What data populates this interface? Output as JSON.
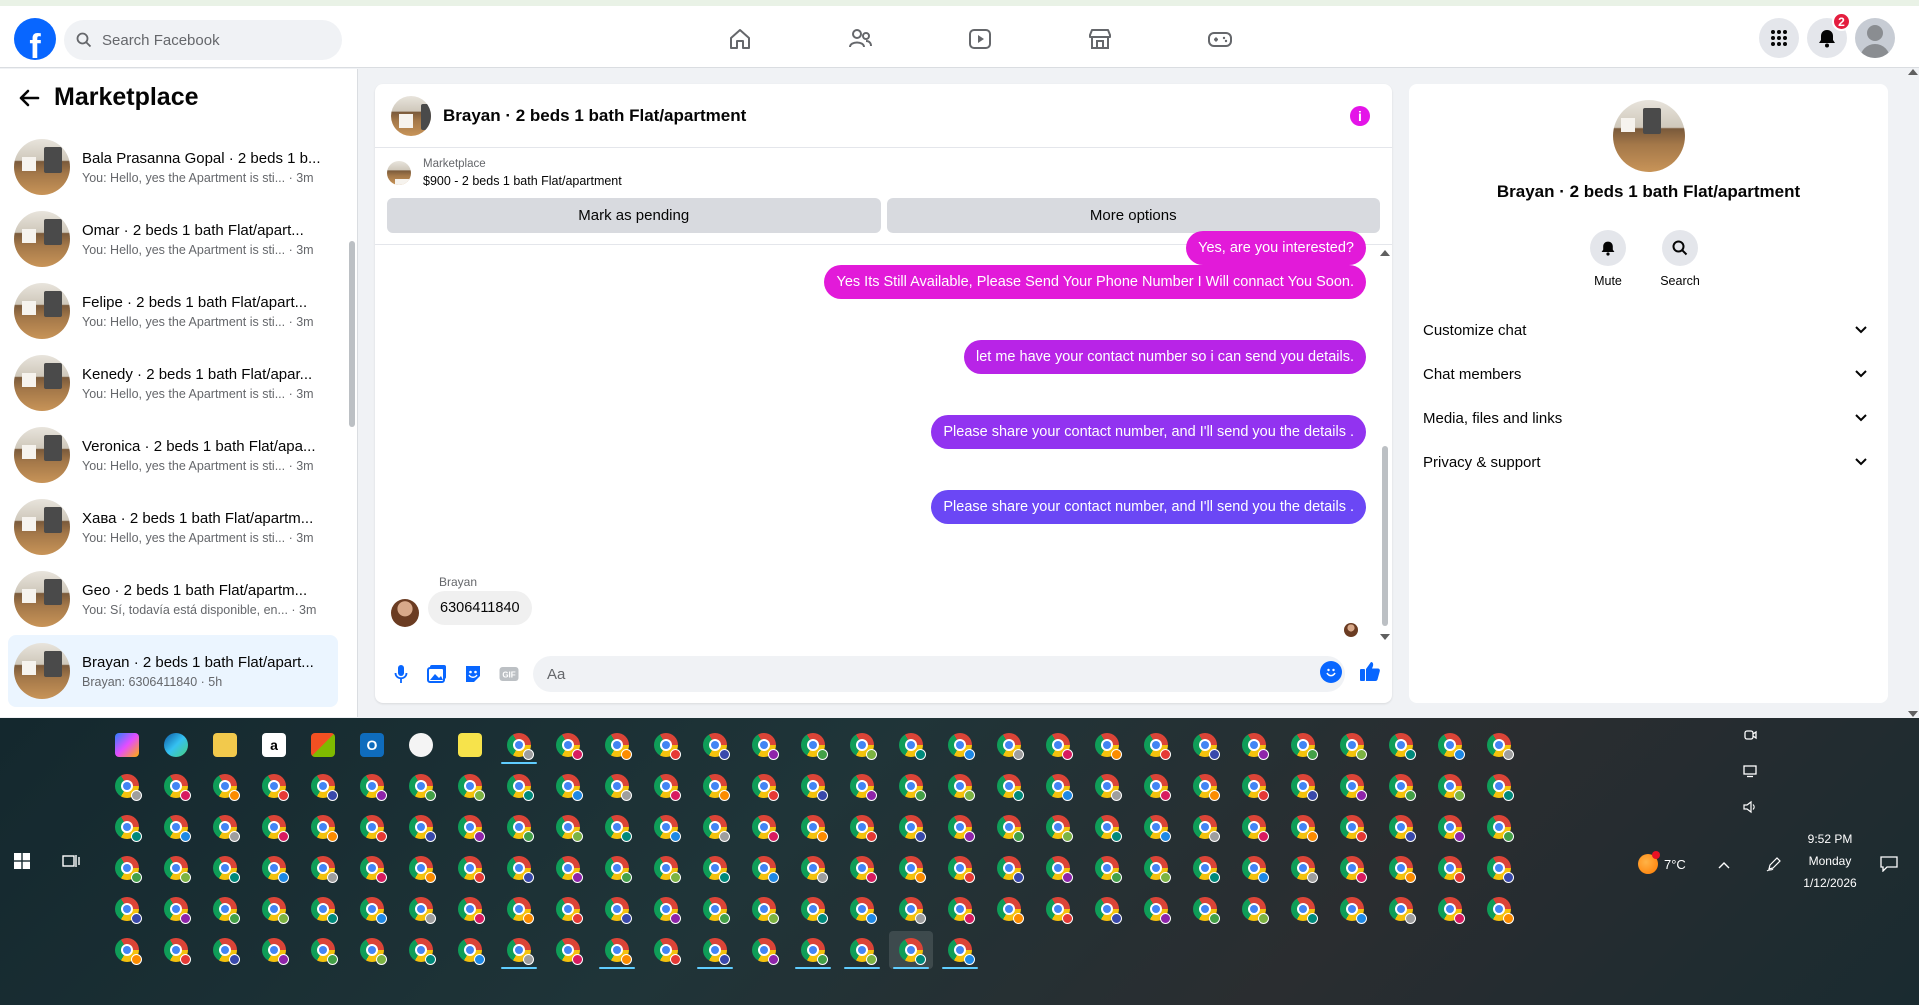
{
  "header": {
    "logo_letter": "f",
    "search_placeholder": "Search Facebook",
    "nav": [
      "home-icon",
      "friends-icon",
      "video-icon",
      "marketplace-icon",
      "gaming-icon"
    ],
    "notification_count": "2"
  },
  "sidebar": {
    "title": "Marketplace",
    "conversations": [
      {
        "title": "Bala Prasanna Gopal · 2 beds 1 b...",
        "preview": "You: Hello, yes the Apartment is sti... · 3m",
        "active": false
      },
      {
        "title": "Omar · 2 beds 1 bath Flat/apart...",
        "preview": "You: Hello, yes the Apartment is sti... · 3m",
        "active": false
      },
      {
        "title": "Felipe · 2 beds 1 bath Flat/apart...",
        "preview": "You: Hello, yes the Apartment is sti... · 3m",
        "active": false
      },
      {
        "title": "Kenedy · 2 beds 1 bath Flat/apar...",
        "preview": "You: Hello, yes the Apartment is sti... · 3m",
        "active": false
      },
      {
        "title": "Veronica · 2 beds 1 bath Flat/apa...",
        "preview": "You: Hello, yes the Apartment is sti... · 3m",
        "active": false
      },
      {
        "title": "Хава · 2 beds 1 bath Flat/apartm...",
        "preview": "You: Hello, yes the Apartment is sti... · 3m",
        "active": false
      },
      {
        "title": "Geo · 2 beds 1 bath Flat/apartm...",
        "preview": "You: Sí, todavía está disponible, en... · 3m",
        "active": false
      },
      {
        "title": "Brayan · 2 beds 1 bath Flat/apart...",
        "preview": "Brayan: 6306411840 · 5h",
        "active": true
      }
    ]
  },
  "chat": {
    "title": "Brayan · 2 beds 1 bath Flat/apartment",
    "listing_source": "Marketplace",
    "listing_price": "$900 - 2 beds 1 bath Flat/apartment",
    "mark_pending_label": "Mark as pending",
    "more_options_label": "More options",
    "cut_message": "Yes, are you interested?",
    "messages_out": [
      "Yes Its Still Available, Please Send Your Phone Number I Will connact You Soon.",
      "let me have your contact number so i can send you details.",
      "Please share your contact number, and I'll send you the details .",
      "Please share your contact number, and I'll send you the details ."
    ],
    "incoming_sender": "Brayan",
    "incoming_message": "6306411840",
    "composer_placeholder": "Aa"
  },
  "details": {
    "title": "Brayan · 2 beds 1 bath Flat/apartment",
    "mute_label": "Mute",
    "search_label": "Search",
    "sections": [
      "Customize chat",
      "Chat members",
      "Media, files and links",
      "Privacy & support"
    ]
  },
  "taskbar": {
    "weather": "7°C",
    "time": "9:52 PM",
    "day": "Monday",
    "date": "1/12/2026"
  },
  "colors": {
    "fb_blue": "#0866ff",
    "bubble_1": "#e21ad9",
    "bubble_2": "#b824e7",
    "bubble_3": "#9233f0",
    "bubble_4": "#6b47f5"
  }
}
